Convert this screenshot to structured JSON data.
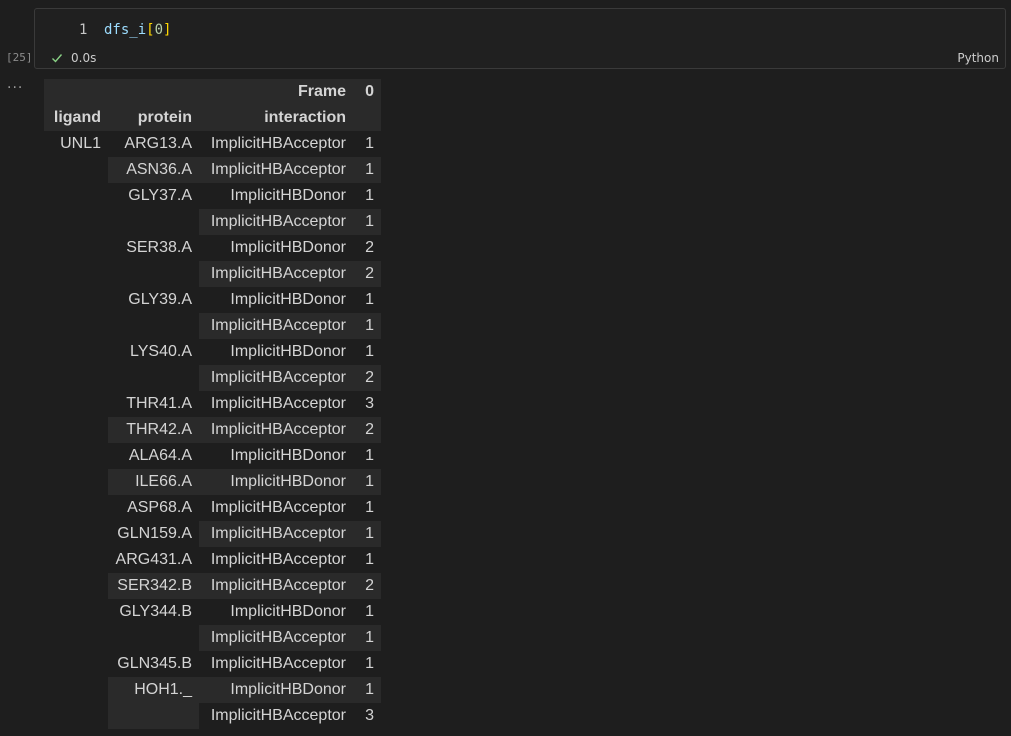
{
  "cell": {
    "execution_count": "[25]",
    "line_number": "1",
    "code": {
      "var": "dfs_i",
      "open": "[",
      "index": "0",
      "close": "]"
    },
    "status_time": "0.0s",
    "language": "Python",
    "output_marker": "..."
  },
  "table": {
    "columns_name": "Frame",
    "column_label": "0",
    "index_names": [
      "ligand",
      "protein",
      "interaction"
    ],
    "rows": [
      {
        "ligand": "UNL1",
        "protein": "ARG13.A",
        "interaction": "ImplicitHBAcceptor",
        "value": "1"
      },
      {
        "ligand": "",
        "protein": "ASN36.A",
        "interaction": "ImplicitHBAcceptor",
        "value": "1"
      },
      {
        "ligand": "",
        "protein": "GLY37.A",
        "interaction": "ImplicitHBDonor",
        "value": "1"
      },
      {
        "ligand": "",
        "protein": "",
        "interaction": "ImplicitHBAcceptor",
        "value": "1"
      },
      {
        "ligand": "",
        "protein": "SER38.A",
        "interaction": "ImplicitHBDonor",
        "value": "2"
      },
      {
        "ligand": "",
        "protein": "",
        "interaction": "ImplicitHBAcceptor",
        "value": "2"
      },
      {
        "ligand": "",
        "protein": "GLY39.A",
        "interaction": "ImplicitHBDonor",
        "value": "1"
      },
      {
        "ligand": "",
        "protein": "",
        "interaction": "ImplicitHBAcceptor",
        "value": "1"
      },
      {
        "ligand": "",
        "protein": "LYS40.A",
        "interaction": "ImplicitHBDonor",
        "value": "1"
      },
      {
        "ligand": "",
        "protein": "",
        "interaction": "ImplicitHBAcceptor",
        "value": "2"
      },
      {
        "ligand": "",
        "protein": "THR41.A",
        "interaction": "ImplicitHBAcceptor",
        "value": "3"
      },
      {
        "ligand": "",
        "protein": "THR42.A",
        "interaction": "ImplicitHBAcceptor",
        "value": "2"
      },
      {
        "ligand": "",
        "protein": "ALA64.A",
        "interaction": "ImplicitHBDonor",
        "value": "1"
      },
      {
        "ligand": "",
        "protein": "ILE66.A",
        "interaction": "ImplicitHBDonor",
        "value": "1"
      },
      {
        "ligand": "",
        "protein": "ASP68.A",
        "interaction": "ImplicitHBAcceptor",
        "value": "1"
      },
      {
        "ligand": "",
        "protein": "GLN159.A",
        "interaction": "ImplicitHBAcceptor",
        "value": "1"
      },
      {
        "ligand": "",
        "protein": "ARG431.A",
        "interaction": "ImplicitHBAcceptor",
        "value": "1"
      },
      {
        "ligand": "",
        "protein": "SER342.B",
        "interaction": "ImplicitHBAcceptor",
        "value": "2"
      },
      {
        "ligand": "",
        "protein": "GLY344.B",
        "interaction": "ImplicitHBDonor",
        "value": "1"
      },
      {
        "ligand": "",
        "protein": "",
        "interaction": "ImplicitHBAcceptor",
        "value": "1"
      },
      {
        "ligand": "",
        "protein": "GLN345.B",
        "interaction": "ImplicitHBAcceptor",
        "value": "1"
      },
      {
        "ligand": "",
        "protein": "HOH1._",
        "interaction": "ImplicitHBDonor",
        "value": "1"
      },
      {
        "ligand": "",
        "protein": "",
        "interaction": "ImplicitHBAcceptor",
        "value": "3"
      }
    ],
    "protein_shaded_rows": [
      1,
      11,
      13,
      17,
      21,
      22
    ]
  },
  "colors": {
    "background": "#1e1e1e",
    "row_shade": "#2a2a2a",
    "success_check": "#89d185"
  },
  "icons": {
    "status": "check-icon"
  }
}
